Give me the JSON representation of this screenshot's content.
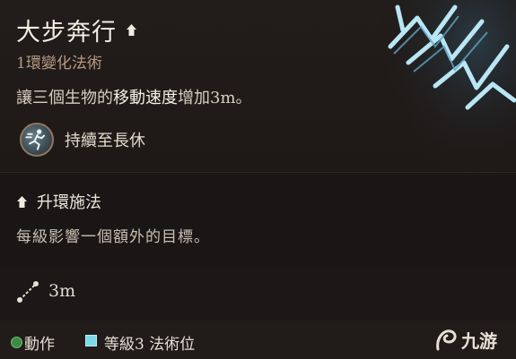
{
  "spell": {
    "name": "大步奔行",
    "school": "1環變化法術",
    "description_parts": [
      "讓三個生物的",
      "移動速度",
      "增加3m。"
    ],
    "duration": "持續至長休"
  },
  "upcast": {
    "title": "升環施法",
    "description": "每級影響一個額外的目標。"
  },
  "range": {
    "value": "3m"
  },
  "costs": {
    "action_label": "動作",
    "slot_label": "等級3 法術位"
  },
  "colors": {
    "action": "#3b8a45",
    "spell_slot": "#7dd8e8",
    "school_text": "#b79a83"
  },
  "icons": {
    "upcast": "chevron-up-icon",
    "duration": "running-figure-icon",
    "range": "range-icon",
    "watermark": "logo"
  },
  "watermark": {
    "text": "九游"
  }
}
